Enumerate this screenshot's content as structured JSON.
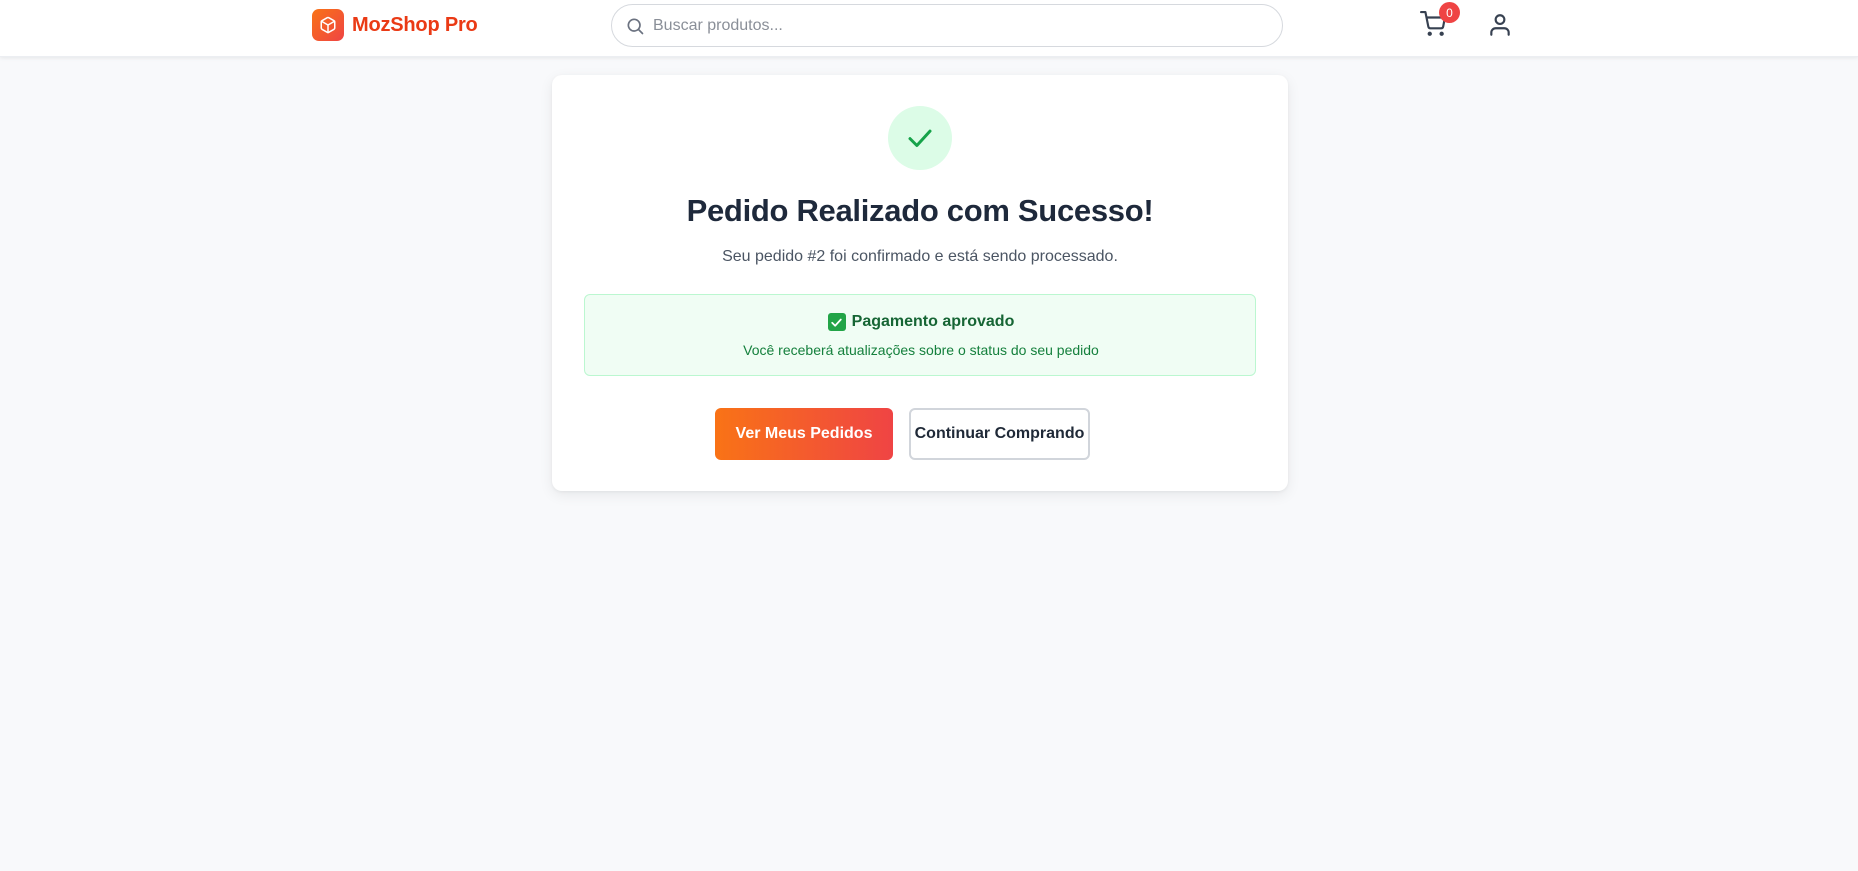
{
  "header": {
    "brand": "MozShop Pro",
    "search_placeholder": "Buscar produtos...",
    "cart_count": "0",
    "icons": {
      "logo": "package-icon",
      "search": "search-icon",
      "cart": "shopping-cart-icon",
      "user": "user-icon"
    }
  },
  "confirmation": {
    "title": "Pedido Realizado com Sucesso!",
    "subtitle": "Seu pedido #2 foi confirmado e está sendo processado.",
    "payment_status": "Pagamento aprovado",
    "payment_note": "Você receberá atualizações sobre o status do seu pedido",
    "primary_button": "Ver Meus Pedidos",
    "secondary_button": "Continuar Comprando"
  },
  "colors": {
    "brand": "#ea3a15",
    "gradient_start": "#f97316",
    "gradient_end": "#ef4444",
    "success_bg": "#f0fdf4",
    "success_text": "#166534",
    "success_icon": "#16a34a",
    "badge": "#ef4444",
    "page_bg": "#f8f9fb"
  }
}
